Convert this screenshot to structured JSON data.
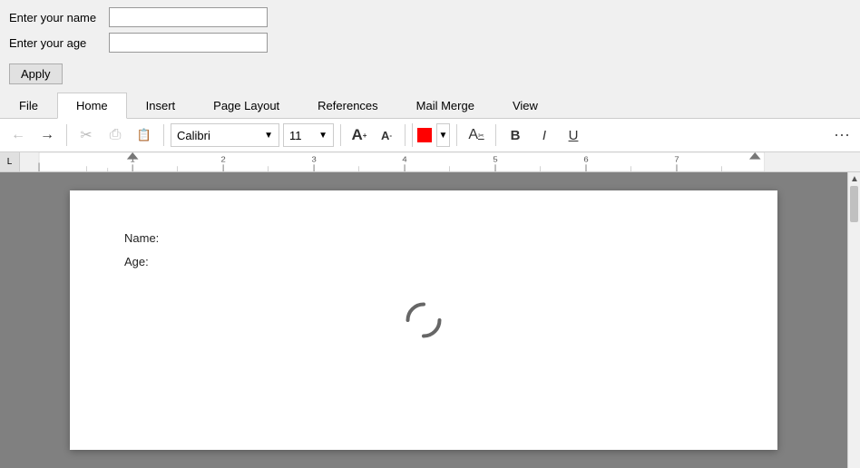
{
  "form": {
    "name_label": "Enter your name",
    "name_placeholder": "",
    "age_label": "Enter your age",
    "age_placeholder": "",
    "apply_button": "Apply"
  },
  "ribbon": {
    "tabs": [
      {
        "label": "File",
        "active": false
      },
      {
        "label": "Home",
        "active": true
      },
      {
        "label": "Insert",
        "active": false
      },
      {
        "label": "Page Layout",
        "active": false
      },
      {
        "label": "References",
        "active": false
      },
      {
        "label": "Mail Merge",
        "active": false
      },
      {
        "label": "View",
        "active": false
      }
    ]
  },
  "toolbar": {
    "undo_label": "←",
    "redo_label": "→",
    "cut_label": "✂",
    "copy_label": "⎘",
    "paste_label": "📋",
    "font_name": "Calibri",
    "font_size": "11",
    "font_grow": "A",
    "font_shrink": "A",
    "font_color": "#ff0000",
    "clear_format_label": "A",
    "bold_label": "B",
    "italic_label": "I",
    "underline_label": "U",
    "more_label": "⋯"
  },
  "document": {
    "name_field": "Name:",
    "age_field": "Age:"
  }
}
